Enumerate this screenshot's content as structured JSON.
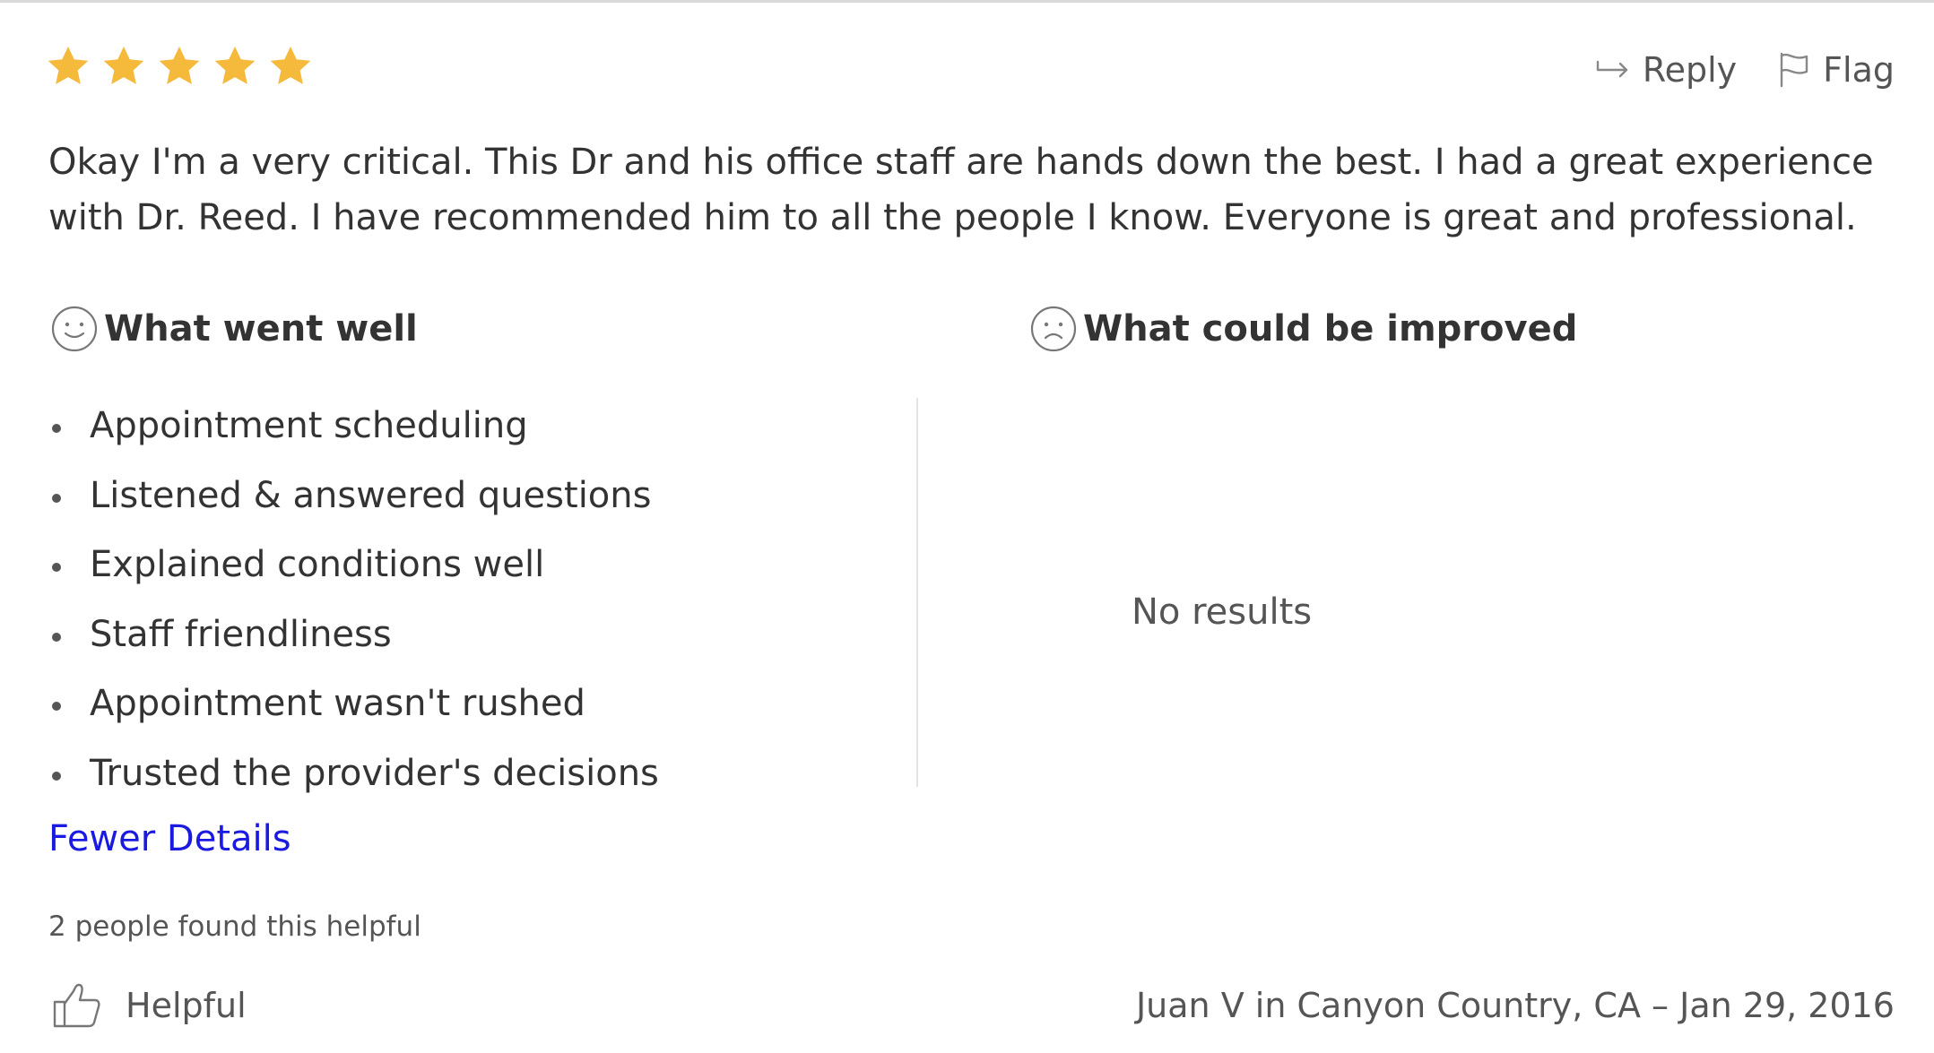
{
  "rating": {
    "stars": 5,
    "max": 5,
    "star_color": "#F5B93B"
  },
  "actions": {
    "reply_label": "Reply",
    "reply_icon": "reply-arrow-icon",
    "flag_label": "Flag",
    "flag_icon": "flag-icon"
  },
  "review": {
    "text": "Okay I'm a very critical. This Dr and his office staff are hands down the best. I had a great experience with Dr. Reed. I have recommended him to all the people I know. Everyone is great and professional."
  },
  "went_well": {
    "title": "What went well",
    "icon": "smiley-face-icon",
    "items": [
      "Appointment scheduling",
      "Listened & answered questions",
      "Explained conditions well",
      "Staff friendliness",
      "Appointment wasn't rushed",
      "Trusted the provider's decisions"
    ]
  },
  "could_improve": {
    "title": "What could be improved",
    "icon": "sad-face-icon",
    "empty_text": "No results"
  },
  "toggle": {
    "label": "Fewer Details",
    "color": "#1A1AE0"
  },
  "helpful": {
    "count_text": "2 people found this helpful",
    "button_label": "Helpful",
    "icon": "thumbs-up-icon"
  },
  "author": {
    "line": "Juan V in Canyon Country, CA – Jan 29, 2016"
  }
}
